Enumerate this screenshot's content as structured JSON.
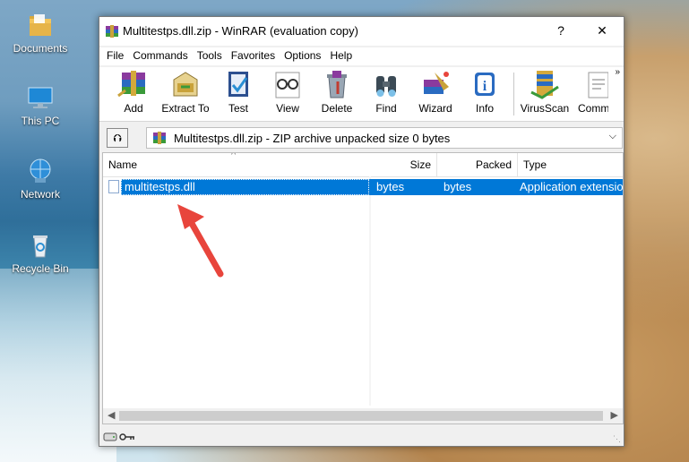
{
  "desktop": {
    "icons": [
      {
        "label": "Documents",
        "icon": "folder-icon"
      },
      {
        "label": "This PC",
        "icon": "computer-icon"
      },
      {
        "label": "Network",
        "icon": "network-icon"
      },
      {
        "label": "Recycle Bin",
        "icon": "recycle-bin-icon"
      }
    ]
  },
  "window": {
    "title": "Multitestps.dll.zip - WinRAR (evaluation copy)",
    "help_button": "?",
    "close_button": "✕"
  },
  "menu": {
    "items": [
      "File",
      "Commands",
      "Tools",
      "Favorites",
      "Options",
      "Help"
    ]
  },
  "toolbar": {
    "buttons": [
      {
        "label": "Add",
        "icon": "add-archive-icon"
      },
      {
        "label": "Extract To",
        "icon": "extract-icon"
      },
      {
        "label": "Test",
        "icon": "test-icon"
      },
      {
        "label": "View",
        "icon": "view-icon"
      },
      {
        "label": "Delete",
        "icon": "delete-icon"
      },
      {
        "label": "Find",
        "icon": "find-binoculars-icon"
      },
      {
        "label": "Wizard",
        "icon": "wizard-icon"
      },
      {
        "label": "Info",
        "icon": "info-icon"
      },
      {
        "label": "VirusScan",
        "icon": "virusscan-icon"
      },
      {
        "label": "Comm",
        "icon": "comment-icon"
      }
    ],
    "more": "»"
  },
  "pathbar": {
    "up_icon": "⮉",
    "path": "Multitestps.dll.zip - ZIP archive unpacked size 0 bytes",
    "dropdown": "⌵"
  },
  "filelist": {
    "columns": [
      "Name",
      "Size",
      "Packed",
      "Type"
    ],
    "sort_indicator": "^",
    "rows": [
      {
        "name": "multitestps.dll",
        "size": "bytes",
        "packed": "bytes",
        "type": "Application extensio"
      }
    ]
  },
  "colors": {
    "selection": "#0078d7",
    "annotation_arrow": "#e8453c"
  }
}
